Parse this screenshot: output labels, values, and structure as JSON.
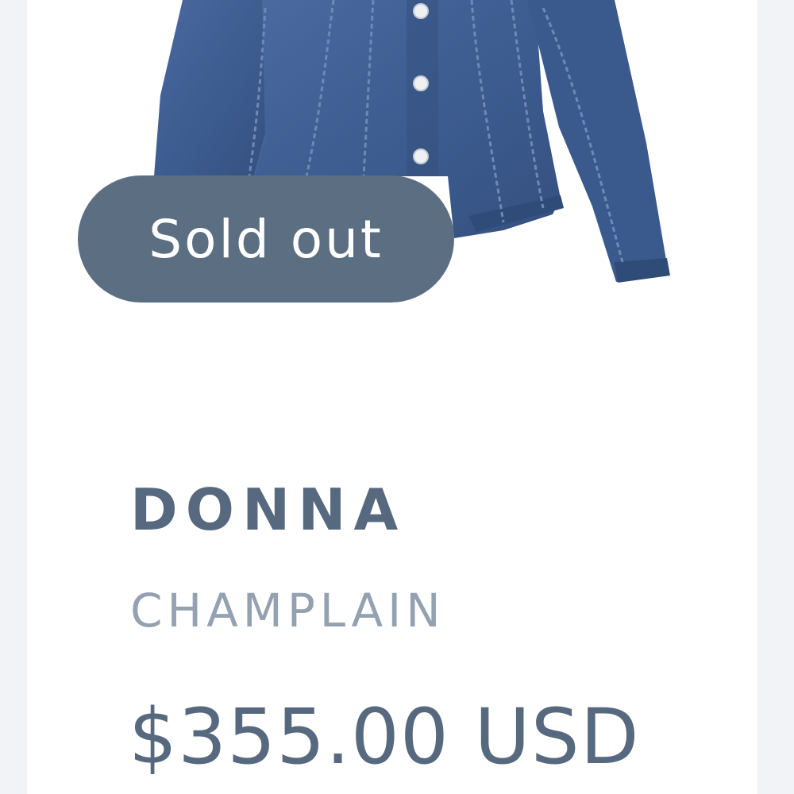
{
  "product": {
    "image_alt": "denim-jacket",
    "badge": "Sold out",
    "brand": "DONNA",
    "name": "CHAMPLAIN",
    "price": "$355.00 USD"
  },
  "colors": {
    "badge_bg": "#5c6e82",
    "brand_text": "#57697f",
    "name_text": "#94a1b1",
    "price_text": "#57697f",
    "denim": "#3f5f92"
  }
}
